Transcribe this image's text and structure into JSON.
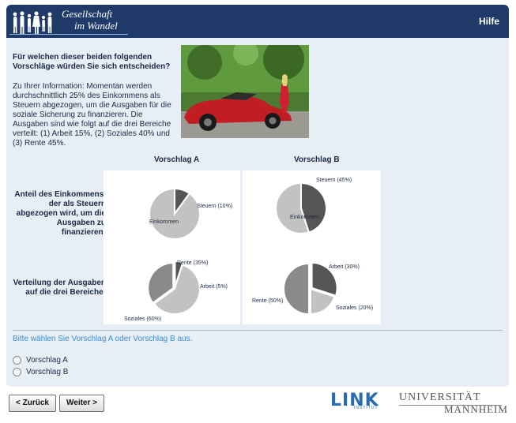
{
  "header": {
    "brand_line1": "Gesellschaft",
    "brand_line2": "im Wandel",
    "help_label": "Hilfe",
    "colors": {
      "bar": "#1f3a68",
      "page_bg": "#e7eef6"
    }
  },
  "question": {
    "title": "Für welchen dieser beiden folgenden Vorschläge würden Sie sich entscheiden?",
    "info": "Zu Ihrer Information: Momentan werden durchschnittlich 25% des Einkommens als Steuern abgezogen, um die Ausgaben für die soziale Sicherung zu finanzieren. Die Ausgaben sind wie folgt auf die drei Bereiche verteilt: (1) Arbeit 15%, (2) Soziales 40% und (3) Rente 45%."
  },
  "table": {
    "col_a": "Vorschlag A",
    "col_b": "Vorschlag B",
    "row1_label": "Anteil des Einkommens, der als Steuern abgezogen wird, um die Ausgaben zu finanzieren:",
    "row2_label": "Verteilung der Ausgaben auf die drei Bereiche:"
  },
  "chart_data": [
    {
      "type": "pie",
      "title": "",
      "slices": [
        {
          "label": "Steuern (10%)",
          "value": 10,
          "color": "#555555"
        },
        {
          "label": "Einkommen",
          "value": 90,
          "color": "#c2c2c2"
        }
      ]
    },
    {
      "type": "pie",
      "title": "",
      "slices": [
        {
          "label": "Steuern (45%)",
          "value": 45,
          "color": "#555555"
        },
        {
          "label": "Einkommen",
          "value": 55,
          "color": "#c2c2c2"
        }
      ]
    },
    {
      "type": "pie",
      "title": "",
      "slices": [
        {
          "label": "Arbeit (5%)",
          "value": 5,
          "color": "#555555"
        },
        {
          "label": "Soziales (60%)",
          "value": 60,
          "color": "#c2c2c2"
        },
        {
          "label": "Rente (35%)",
          "value": 35,
          "color": "#8a8a8a"
        }
      ]
    },
    {
      "type": "pie",
      "title": "",
      "slices": [
        {
          "label": "Arbeit (30%)",
          "value": 30,
          "color": "#555555"
        },
        {
          "label": "Soziales (20%)",
          "value": 20,
          "color": "#c2c2c2"
        },
        {
          "label": "Rente (50%)",
          "value": 50,
          "color": "#8a8a8a"
        }
      ]
    }
  ],
  "instruction": "Bitte wählen Sie Vorschlag A oder Vorschlag B aus.",
  "options": [
    "Vorschlag A",
    "Vorschlag B"
  ],
  "nav": {
    "back_label": "< Zurück",
    "next_label": "Weiter >"
  },
  "footer": {
    "link_logo": "LINK",
    "link_sub": "INSTITUT",
    "uni_line1": "UNIVERSITÄT",
    "uni_line2": "MANNHEIM"
  }
}
